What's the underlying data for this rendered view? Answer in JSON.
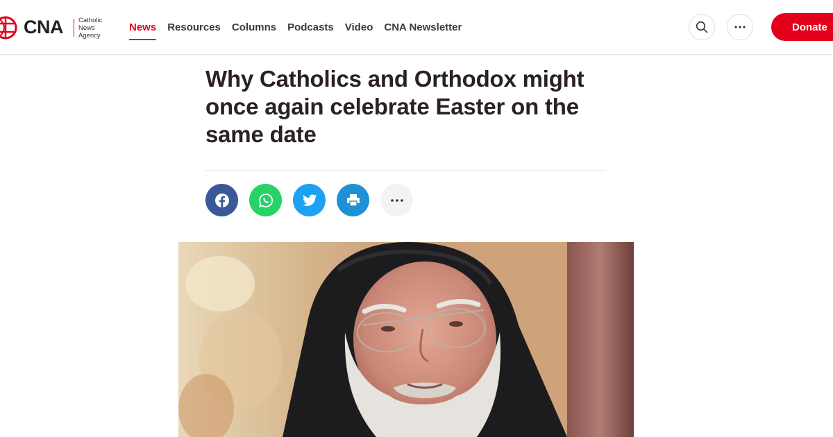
{
  "brand": {
    "name": "CNA",
    "subtitle": [
      "Catholic",
      "News",
      "Agency"
    ],
    "accent_color": "#e2001a"
  },
  "nav": {
    "items": [
      {
        "label": "News",
        "active": true
      },
      {
        "label": "Resources",
        "active": false
      },
      {
        "label": "Columns",
        "active": false
      },
      {
        "label": "Podcasts",
        "active": false
      },
      {
        "label": "Video",
        "active": false
      },
      {
        "label": "CNA Newsletter",
        "active": false
      }
    ]
  },
  "header_actions": {
    "search_icon": "search-icon",
    "more_icon": "ellipsis-icon",
    "donate_label": "Donate"
  },
  "article": {
    "headline": "Why Catholics and Orthodox might once again celebrate Easter on the same date"
  },
  "share": {
    "buttons": [
      {
        "name": "facebook",
        "icon": "facebook-icon",
        "color": "#3b5998"
      },
      {
        "name": "whatsapp",
        "icon": "whatsapp-icon",
        "color": "#25d366"
      },
      {
        "name": "twitter",
        "icon": "twitter-icon",
        "color": "#1da1f2"
      },
      {
        "name": "print",
        "icon": "printer-icon",
        "color": "#1e90d6"
      },
      {
        "name": "more",
        "icon": "ellipsis-icon",
        "color": "#f3f3f3"
      }
    ]
  }
}
